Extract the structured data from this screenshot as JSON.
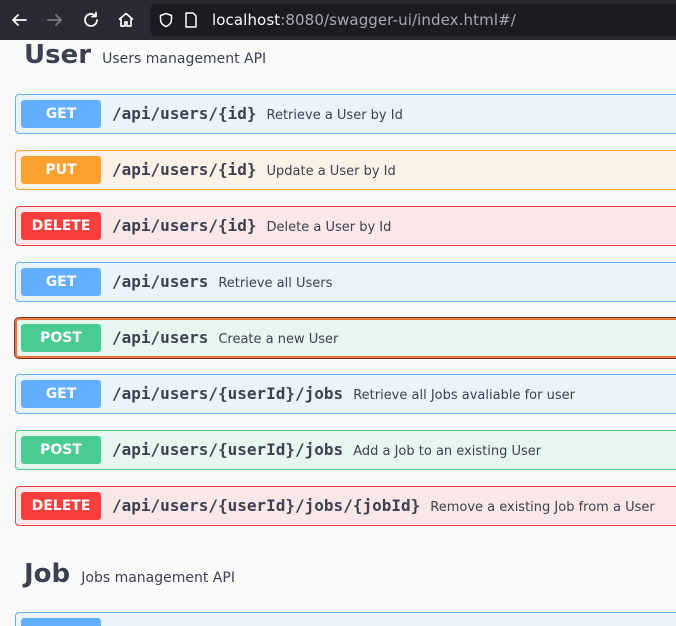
{
  "browser": {
    "url_host": "localhost",
    "url_rest": ":8080/swagger-ui/index.html#/"
  },
  "sections": [
    {
      "title": "User",
      "description": "Users management API"
    },
    {
      "title": "Job",
      "description": "Jobs management API"
    }
  ],
  "operations": [
    {
      "method": "GET",
      "path": "/api/users/{id}",
      "summary": "Retrieve a User by Id"
    },
    {
      "method": "PUT",
      "path": "/api/users/{id}",
      "summary": "Update a User by Id"
    },
    {
      "method": "DELETE",
      "path": "/api/users/{id}",
      "summary": "Delete a User by Id"
    },
    {
      "method": "GET",
      "path": "/api/users",
      "summary": "Retrieve all Users"
    },
    {
      "method": "POST",
      "path": "/api/users",
      "summary": "Create a new User"
    },
    {
      "method": "GET",
      "path": "/api/users/{userId}/jobs",
      "summary": "Retrieve all Jobs avaliable for user"
    },
    {
      "method": "POST",
      "path": "/api/users/{userId}/jobs",
      "summary": "Add a Job to an existing User"
    },
    {
      "method": "DELETE",
      "path": "/api/users/{userId}/jobs/{jobId}",
      "summary": "Remove a existing Job from a User"
    }
  ]
}
